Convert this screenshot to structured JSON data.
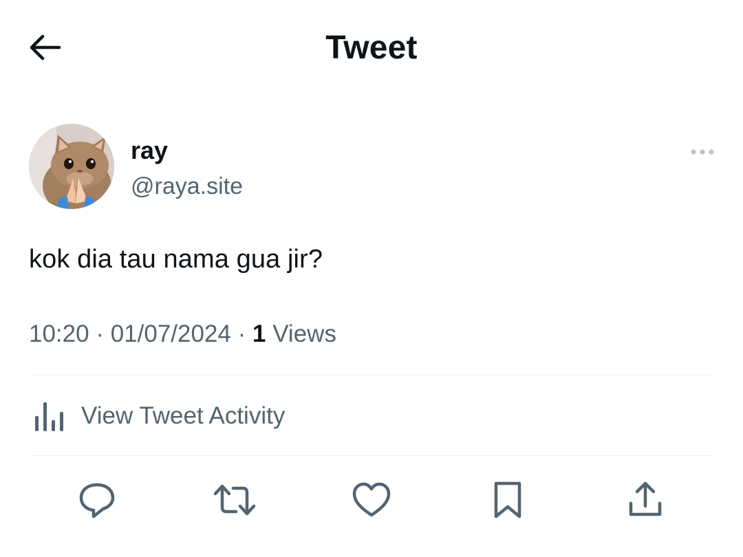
{
  "header": {
    "title": "Tweet",
    "back_icon": "arrow-left-icon"
  },
  "tweet": {
    "author": {
      "display_name": "ray",
      "handle": "@raya.site",
      "avatar": "cat-praying-hands-avatar"
    },
    "text": "kok dia tau nama gua jir?",
    "time": "10:20",
    "date": "01/07/2024",
    "views_count": "1",
    "views_label": "Views",
    "separator": "·"
  },
  "activity": {
    "label": "View Tweet Activity",
    "icon": "bar-chart-icon"
  },
  "actions": [
    {
      "name": "reply",
      "icon": "reply-icon"
    },
    {
      "name": "retweet",
      "icon": "retweet-icon"
    },
    {
      "name": "like",
      "icon": "heart-icon"
    },
    {
      "name": "bookmark",
      "icon": "bookmark-icon"
    },
    {
      "name": "share",
      "icon": "share-icon"
    }
  ],
  "colors": {
    "primary_text": "#0f1419",
    "secondary_text": "#536471",
    "divider": "#eff3f4",
    "background": "#ffffff"
  }
}
